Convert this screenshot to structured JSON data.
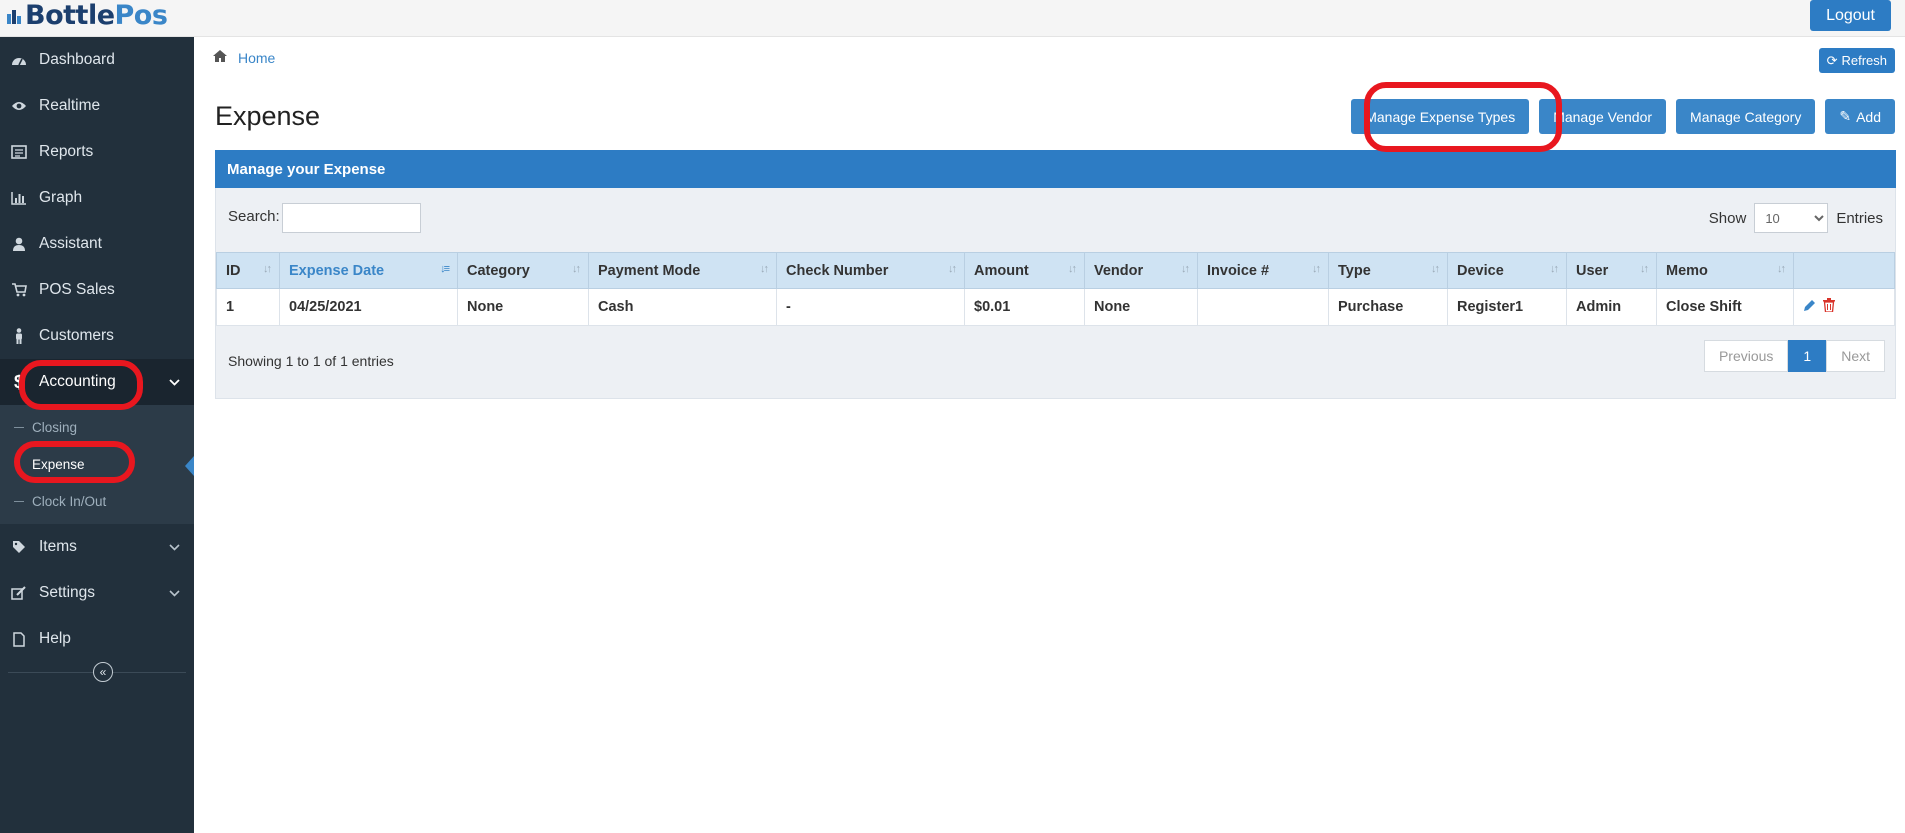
{
  "app": {
    "logo_part1": "Bottle",
    "logo_part2": "Pos",
    "logout_label": "Logout"
  },
  "sidebar": {
    "items": [
      {
        "label": "Dashboard",
        "icon": "dashboard-icon"
      },
      {
        "label": "Realtime",
        "icon": "eye-icon"
      },
      {
        "label": "Reports",
        "icon": "report-icon"
      },
      {
        "label": "Graph",
        "icon": "bar-chart-icon"
      },
      {
        "label": "Assistant",
        "icon": "user-icon"
      },
      {
        "label": "POS Sales",
        "icon": "cart-icon"
      },
      {
        "label": "Customers",
        "icon": "person-icon"
      },
      {
        "label": "Accounting",
        "icon": "dollar-icon"
      },
      {
        "label": "Items",
        "icon": "tag-icon"
      },
      {
        "label": "Settings",
        "icon": "edit-icon"
      },
      {
        "label": "Help",
        "icon": "file-icon"
      }
    ],
    "accounting_sub": [
      {
        "label": "Closing"
      },
      {
        "label": "Expense"
      },
      {
        "label": "Clock In/Out"
      }
    ]
  },
  "breadcrumb": {
    "home": "Home"
  },
  "header": {
    "refresh_label": "Refresh",
    "title": "Expense"
  },
  "actions": {
    "manage_expense_types": "Manage Expense Types",
    "manage_vendor": "Manage Vendor",
    "manage_category": "Manage Category",
    "add": "Add"
  },
  "panel": {
    "title": "Manage your Expense",
    "search_label": "Search:",
    "search_value": "",
    "show_label": "Show",
    "show_value": "10",
    "entries_label": "Entries"
  },
  "table": {
    "columns": [
      "ID",
      "Expense Date",
      "Category",
      "Payment Mode",
      "Check Number",
      "Amount",
      "Vendor",
      "Invoice #",
      "Type",
      "Device",
      "User",
      "Memo"
    ],
    "rows": [
      {
        "id": "1",
        "date": "04/25/2021",
        "category": "None",
        "payment_mode": "Cash",
        "check_number": "-",
        "amount": "$0.01",
        "vendor": "None",
        "invoice": "",
        "type": "Purchase",
        "device": "Register1",
        "user": "Admin",
        "memo": "Close Shift"
      }
    ]
  },
  "footer": {
    "info": "Showing 1 to 1 of 1 entries",
    "prev": "Previous",
    "page": "1",
    "next": "Next"
  },
  "colors": {
    "primary": "#2d7cc4",
    "sidebar": "#22303c",
    "highlight": "#e8171f"
  }
}
